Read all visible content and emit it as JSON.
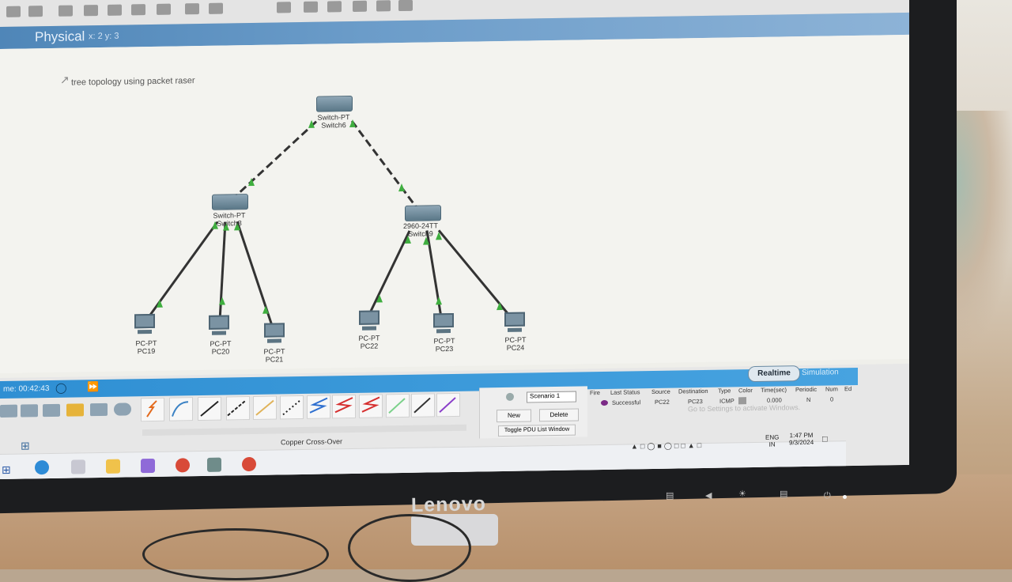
{
  "workspace": {
    "tab_label": "Physical",
    "tab_extra": "x: 2 y: 3",
    "note": "tree topology using packet raser"
  },
  "devices": {
    "switch6": {
      "type": "Switch-PT",
      "name": "Switch6"
    },
    "switch8": {
      "type": "Switch-PT",
      "name": "Switch8"
    },
    "switch9": {
      "type": "2960-24TT",
      "name": "Switch9"
    },
    "pc19": {
      "type": "PC-PT",
      "name": "PC19"
    },
    "pc20": {
      "type": "PC-PT",
      "name": "PC20"
    },
    "pc21": {
      "type": "PC-PT",
      "name": "PC21"
    },
    "pc22": {
      "type": "PC-PT",
      "name": "PC22"
    },
    "pc23": {
      "type": "PC-PT",
      "name": "PC23"
    },
    "pc24": {
      "type": "PC-PT",
      "name": "PC24"
    }
  },
  "timebar": {
    "time": "me: 00:42:43",
    "realtime": "Realtime",
    "simulation": "Simulation"
  },
  "connections": {
    "caption": "Copper Cross-Over"
  },
  "pdu": {
    "scenario": "Scenario 1",
    "new_label": "New",
    "delete_label": "Delete",
    "toggle_label": "Toggle PDU List Window",
    "headers": [
      "Fire",
      "Last Status",
      "Source",
      "Destination",
      "Type",
      "Color",
      "Time(sec)",
      "Periodic",
      "Num",
      "Ed"
    ],
    "row": [
      "Successful",
      "PC22",
      "PC23",
      "ICMP",
      "",
      "0.000",
      "N",
      "0"
    ]
  },
  "watermark": "Go to Settings to activate Windows.",
  "taskbar": {
    "lang_top": "ENG",
    "lang_bottom": "IN",
    "time": "1:47 PM",
    "date": "9/3/2024"
  },
  "monitor": {
    "brand": "Lenovo"
  },
  "colors": {
    "link": "#333333",
    "port_ok": "#3fae3f",
    "timebar": "#2f8fd3"
  }
}
